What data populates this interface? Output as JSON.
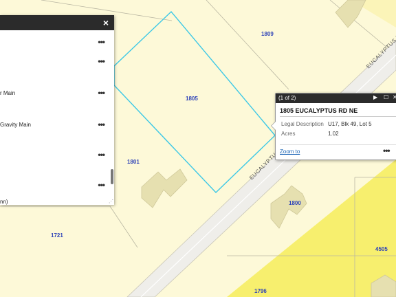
{
  "layer_panel": {
    "close_icon": "×",
    "more_icon": "•••",
    "items": [
      {
        "label": ""
      },
      {
        "label": ""
      },
      {
        "label": "r Main"
      },
      {
        "label": "Gravity Main"
      },
      {
        "label": ""
      },
      {
        "label": ""
      },
      {
        "label": "nn)"
      }
    ],
    "grip_icon": "⋰"
  },
  "map": {
    "colors": {
      "parcel_fill": "#fdf9d8",
      "zoned_fill": "#f7ef6e",
      "road": "#efeeea",
      "selection": "#3cc8e6",
      "building": "#e6e0b0"
    },
    "parcel_labels": [
      "1809",
      "1805",
      "1801",
      "1800",
      "1721",
      "4505",
      "1796"
    ],
    "road_label_lower": "EUCALYPTUS R",
    "road_label_upper": "EUCALYPTUS R"
  },
  "popup": {
    "pager": "(1 of 2)",
    "play_icon": "▶",
    "maximize_icon": "☐",
    "close_icon": "✕",
    "title": "1805 EUCALYPTUS RD NE",
    "fields": [
      {
        "key": "Legal Description",
        "value": "U17, Blk 49, Lot 5"
      },
      {
        "key": "Acres",
        "value": "1.02"
      }
    ],
    "zoom_link": "Zoom to",
    "more_icon": "•••"
  }
}
